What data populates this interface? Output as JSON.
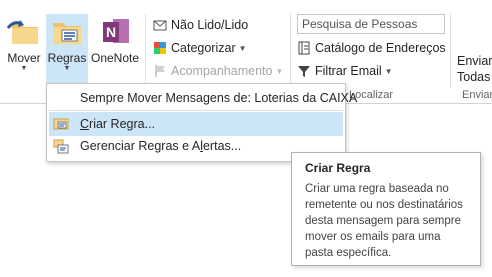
{
  "ribbon": {
    "move": {
      "label": "Mover"
    },
    "rules": {
      "label": "Regras"
    },
    "onenote": {
      "label": "OneNote"
    },
    "tags": {
      "unread_read": "Não Lido/Lido",
      "categorize": "Categorizar",
      "followup": "Acompanhamento"
    },
    "find": {
      "search_placeholder": "Pesquisa de Pessoas",
      "address_book": "Catálogo de Endereços",
      "filter_email": "Filtrar Email",
      "group_label": "Localizar"
    },
    "send": {
      "line1": "Enviar/",
      "line2": "Todas",
      "group_label": "Enviar/"
    }
  },
  "menu": {
    "always_move": "Sempre Mover Mensagens de: Loterias da CAIXA",
    "create_rule": "Criar Regra...",
    "manage_rules": "Gerenciar Regras e Alertas..."
  },
  "tooltip": {
    "title": "Criar Regra",
    "lines": [
      "Criar uma regra baseada no",
      "remetente ou nos destinatários",
      "desta mensagem para sempre",
      "mover os emails para uma",
      "pasta específica."
    ]
  },
  "colors": {
    "highlight": "#cde6f7",
    "rules_button_bg": "#cde6f7",
    "onenote": "#80397b",
    "folder": "#f0c36d",
    "accent_blue": "#2b579a"
  },
  "icons": {
    "move": "folder-arrow-icon",
    "rules": "folder-rules-icon",
    "onenote": "onenote-icon",
    "unread": "envelope-icon",
    "categorize": "tag-icon",
    "followup": "flag-icon",
    "address_book": "address-book-icon",
    "filter": "funnel-icon",
    "create_rule": "create-rule-icon",
    "manage_rules": "manage-rules-icon"
  }
}
